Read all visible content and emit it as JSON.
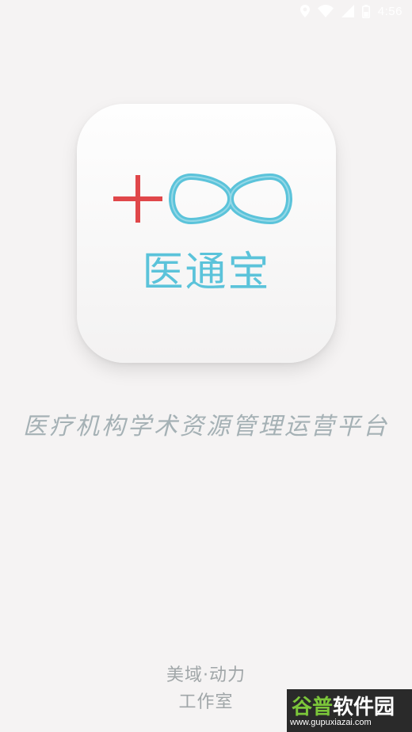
{
  "status_bar": {
    "time": "4:56",
    "icons": [
      "location-icon",
      "wifi-icon",
      "signal-icon",
      "battery-icon"
    ]
  },
  "app": {
    "name": "医通宝",
    "logo_colors": {
      "cross": "#e0474a",
      "infinity": "#5bc3da"
    }
  },
  "tagline": "医疗机构学术资源管理运营平台",
  "studio": {
    "line1": "美域·动力",
    "line2": "工作室"
  },
  "watermark": {
    "title_green": "谷普",
    "title_white": "软件园",
    "url": "www.gupuxiazai.com"
  },
  "colors": {
    "background": "#f5f3f3",
    "accent": "#5bc3da",
    "tagline": "#a5b1b5"
  }
}
